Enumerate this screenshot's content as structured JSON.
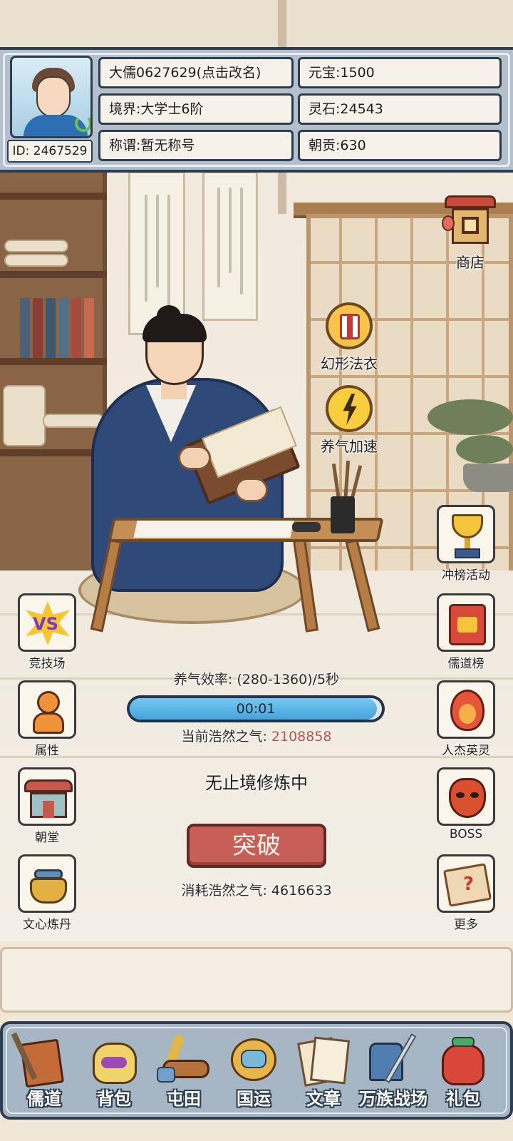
{
  "player": {
    "name": "大儒0627629(点击改名)",
    "realm": "境界:大学士6阶",
    "title": "称谓:暂无称号",
    "id": "ID: 2467529"
  },
  "resources": {
    "yuanbao": "元宝:1500",
    "lingshi": "灵石:24543",
    "chaogong": "朝贡:630"
  },
  "top_right": {
    "shop_label": "商店"
  },
  "floating_buttons": {
    "costume_label": "幻形法衣",
    "accelerate_label": "养气加速"
  },
  "left_buttons": [
    {
      "label": "竞技场",
      "icon": "vs-icon"
    },
    {
      "label": "属性",
      "icon": "attribute-figure-icon"
    },
    {
      "label": "朝堂",
      "icon": "court-hall-icon"
    },
    {
      "label": "文心炼丹",
      "icon": "alchemy-cauldron-icon"
    }
  ],
  "right_buttons": [
    {
      "label": "冲榜活动",
      "icon": "trophy-icon"
    },
    {
      "label": "儒道榜",
      "icon": "ranking-scroll-icon"
    },
    {
      "label": "人杰英灵",
      "icon": "flame-spirit-icon"
    },
    {
      "label": "BOSS",
      "icon": "demon-mask-icon"
    },
    {
      "label": "更多",
      "icon": "map-scroll-icon"
    }
  ],
  "cultivation": {
    "efficiency": "养气效率: (280-1360)/5秒",
    "timer": "00:01",
    "progress_fraction": 0.98,
    "current_label": "当前浩然之气: ",
    "current_value": "2108858",
    "status": "无止境修炼中",
    "breakthrough_label": "突破",
    "cost_text": "消耗浩然之气: 4616633"
  },
  "bottom_nav": [
    {
      "label": "儒道",
      "icon": "brush-book-icon"
    },
    {
      "label": "背包",
      "icon": "bag-icon"
    },
    {
      "label": "屯田",
      "icon": "wheat-log-icon"
    },
    {
      "label": "国运",
      "icon": "dragon-icon"
    },
    {
      "label": "文章",
      "icon": "papers-icon"
    },
    {
      "label": "万族战场",
      "icon": "sword-armor-icon"
    },
    {
      "label": "礼包",
      "icon": "gift-bag-icon"
    }
  ],
  "colors": {
    "panel_border": "#2c3e50",
    "panel_bg": "#b4c0cc",
    "accent_red": "#c55f57",
    "progress_blue": "#45a4db"
  }
}
